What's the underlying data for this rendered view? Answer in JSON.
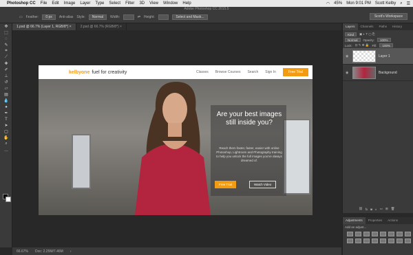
{
  "menubar": {
    "apple": "",
    "app": "Photoshop CC",
    "items": [
      "File",
      "Edit",
      "Image",
      "Layer",
      "Type",
      "Select",
      "Filter",
      "3D",
      "View",
      "Window",
      "Help"
    ],
    "battery": "45%",
    "clock": "Mon 9:01 PM",
    "user": "Scott Kelby"
  },
  "titlebar": {
    "title": "Adobe Photoshop CC 2015.5"
  },
  "options": {
    "feather_label": "Feather:",
    "feather_value": "0 px",
    "antialias": "Anti-alias",
    "style_label": "Style:",
    "style_value": "Normal",
    "width_label": "Width:",
    "height_label": "Height:",
    "refine": "Select and Mask...",
    "workspace": "Scott's Workspace"
  },
  "doc_tabs": [
    {
      "label": "1.psd @ 66.7% (Layer 1, RGB/8*) ×"
    },
    {
      "label": "2.psd @ 66.7% (RGB/8*) ×"
    }
  ],
  "site": {
    "logo_k": "kelbyone",
    "logo_tag": "fuel for creativity",
    "nav": [
      "Classes",
      "Browse Courses",
      "Search",
      "Sign In"
    ],
    "nav_button": "Free Trial",
    "headline": "Are your best images still inside you?",
    "body": "Reach them faster, faster, easier with online Photoshop, Lightroom and Photography training to help you unlock the full images you've always dreamed of.",
    "cta_primary": "Free Trial",
    "cta_secondary": "Watch Video"
  },
  "status": {
    "zoom": "66.67%",
    "doc": "Doc: 2.25M/7.46M"
  },
  "layers_panel": {
    "tabs": [
      "Layers",
      "Channels",
      "Paths",
      "History"
    ],
    "kind": "Kind",
    "blend": "Normal",
    "opacity_label": "Opacity:",
    "opacity": "100%",
    "lock_label": "Lock:",
    "fill_label": "Fill:",
    "fill": "100%",
    "layers": [
      {
        "name": "Layer 1"
      },
      {
        "name": "Background"
      }
    ]
  },
  "adjustments_panel": {
    "tabs": [
      "Adjustments",
      "Properties",
      "Actions"
    ],
    "title": "Add an adjust..."
  }
}
